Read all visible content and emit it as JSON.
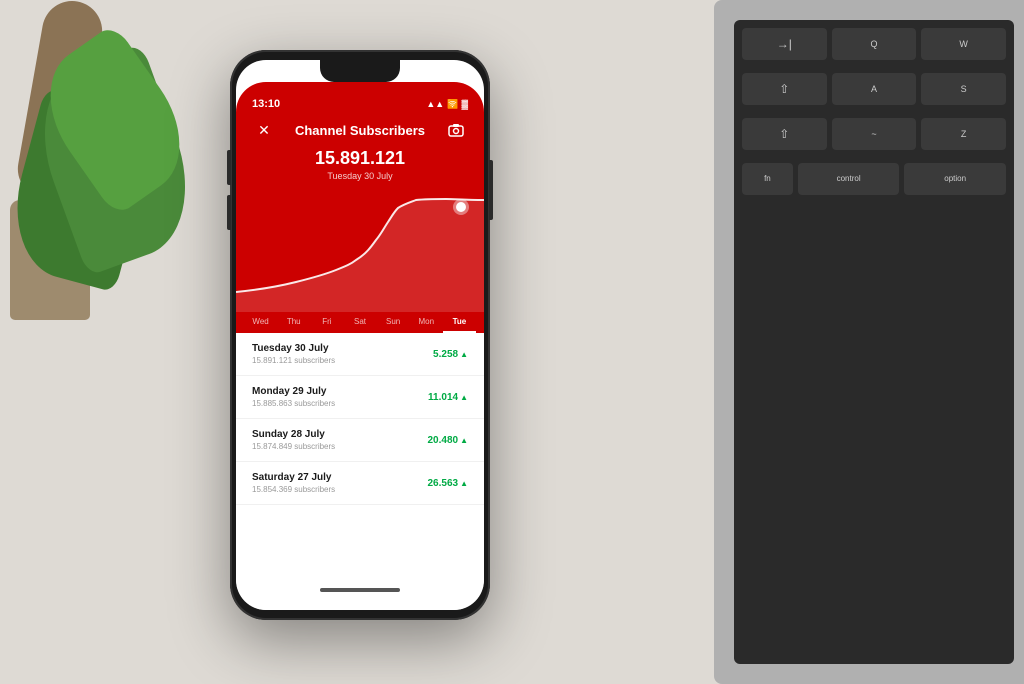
{
  "desk": {
    "background_color": "#dedad4"
  },
  "phone": {
    "status_bar": {
      "time": "13:10",
      "icons": [
        "signal",
        "wifi",
        "battery"
      ]
    },
    "header": {
      "title": "Channel Subscribers",
      "close_icon": "✕",
      "camera_icon": "⊡"
    },
    "subscriber_count": "15.891.121",
    "subscriber_date": "Tuesday 30 July",
    "chart": {
      "dot_color": "#ffffff"
    },
    "day_tabs": [
      {
        "label": "Wed",
        "active": false
      },
      {
        "label": "Thu",
        "active": false
      },
      {
        "label": "Fri",
        "active": false
      },
      {
        "label": "Sat",
        "active": false
      },
      {
        "label": "Sun",
        "active": false
      },
      {
        "label": "Mon",
        "active": false
      },
      {
        "label": "Tue",
        "active": true
      }
    ],
    "stats": [
      {
        "date": "Tuesday 30 July",
        "subscribers": "15.891.121 subscribers",
        "value": "5.258",
        "trend": "▲"
      },
      {
        "date": "Monday 29 July",
        "subscribers": "15.885.863 subscribers",
        "value": "11.014",
        "trend": "▲"
      },
      {
        "date": "Sunday 28 July",
        "subscribers": "15.874.849 subscribers",
        "value": "20.480",
        "trend": "▲"
      },
      {
        "date": "Saturday 27 July",
        "subscribers": "15.854.369 subscribers",
        "value": "26.563",
        "trend": "▲"
      }
    ]
  },
  "keyboard": {
    "rows": [
      [
        "→|",
        "Q",
        "W"
      ],
      [
        "⇧",
        "A",
        "S"
      ],
      [
        "⇧",
        "`",
        "Z"
      ],
      [
        "fn",
        "control",
        "option"
      ]
    ]
  }
}
